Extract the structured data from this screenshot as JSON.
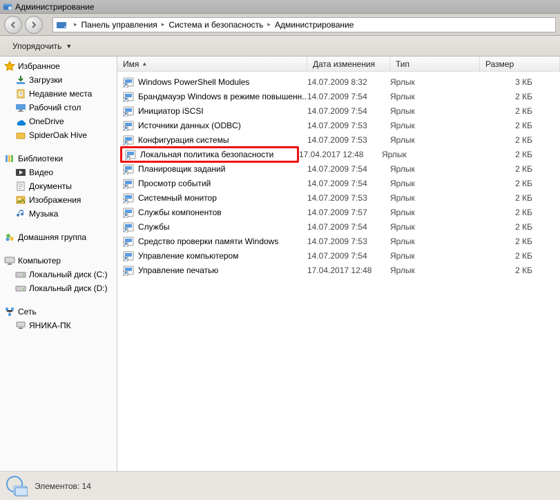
{
  "window_title": "Администрирование",
  "breadcrumbs": [
    "Панель управления",
    "Система и безопасность",
    "Администрирование"
  ],
  "toolbar": {
    "organize": "Упорядочить"
  },
  "columns": {
    "name": "Имя",
    "date": "Дата изменения",
    "type": "Тип",
    "size": "Размер"
  },
  "sidebar": {
    "groups": [
      {
        "header": "Избранное",
        "icon": "star-icon",
        "items": [
          {
            "icon": "download-icon",
            "label": "Загрузки"
          },
          {
            "icon": "recent-icon",
            "label": "Недавние места"
          },
          {
            "icon": "desktop-icon",
            "label": "Рабочий стол"
          },
          {
            "icon": "onedrive-icon",
            "label": "OneDrive"
          },
          {
            "icon": "spideroak-icon",
            "label": "SpiderOak Hive"
          }
        ]
      },
      {
        "header": "Библиотеки",
        "icon": "libraries-icon",
        "items": [
          {
            "icon": "video-icon",
            "label": "Видео"
          },
          {
            "icon": "docs-icon",
            "label": "Документы"
          },
          {
            "icon": "images-icon",
            "label": "Изображения"
          },
          {
            "icon": "music-icon",
            "label": "Музыка"
          }
        ]
      },
      {
        "header": "Домашняя группа",
        "icon": "homegroup-icon",
        "items": []
      },
      {
        "header": "Компьютер",
        "icon": "computer-icon",
        "items": [
          {
            "icon": "drive-icon",
            "label": "Локальный диск (C:)"
          },
          {
            "icon": "drive-icon",
            "label": "Локальный диск (D:)"
          }
        ]
      },
      {
        "header": "Сеть",
        "icon": "network-icon",
        "items": [
          {
            "icon": "pc-icon",
            "label": "ЯНИКА-ПК"
          }
        ]
      }
    ]
  },
  "files": [
    {
      "name": "Windows PowerShell Modules",
      "date": "14.07.2009 8:32",
      "type": "Ярлык",
      "size": "3 КБ",
      "highlight": false
    },
    {
      "name": "Брандмауэр Windows в режиме повышенн...",
      "date": "14.07.2009 7:54",
      "type": "Ярлык",
      "size": "2 КБ",
      "highlight": false
    },
    {
      "name": "Инициатор iSCSI",
      "date": "14.07.2009 7:54",
      "type": "Ярлык",
      "size": "2 КБ",
      "highlight": false
    },
    {
      "name": "Источники данных (ODBC)",
      "date": "14.07.2009 7:53",
      "type": "Ярлык",
      "size": "2 КБ",
      "highlight": false
    },
    {
      "name": "Конфигурация системы",
      "date": "14.07.2009 7:53",
      "type": "Ярлык",
      "size": "2 КБ",
      "highlight": false
    },
    {
      "name": "Локальная политика безопасности",
      "date": "17.04.2017 12:48",
      "type": "Ярлык",
      "size": "2 КБ",
      "highlight": true
    },
    {
      "name": "Планировщик заданий",
      "date": "14.07.2009 7:54",
      "type": "Ярлык",
      "size": "2 КБ",
      "highlight": false
    },
    {
      "name": "Просмотр событий",
      "date": "14.07.2009 7:54",
      "type": "Ярлык",
      "size": "2 КБ",
      "highlight": false
    },
    {
      "name": "Системный монитор",
      "date": "14.07.2009 7:53",
      "type": "Ярлык",
      "size": "2 КБ",
      "highlight": false
    },
    {
      "name": "Службы компонентов",
      "date": "14.07.2009 7:57",
      "type": "Ярлык",
      "size": "2 КБ",
      "highlight": false
    },
    {
      "name": "Службы",
      "date": "14.07.2009 7:54",
      "type": "Ярлык",
      "size": "2 КБ",
      "highlight": false
    },
    {
      "name": "Средство проверки памяти Windows",
      "date": "14.07.2009 7:53",
      "type": "Ярлык",
      "size": "2 КБ",
      "highlight": false
    },
    {
      "name": "Управление компьютером",
      "date": "14.07.2009 7:54",
      "type": "Ярлык",
      "size": "2 КБ",
      "highlight": false
    },
    {
      "name": "Управление печатью",
      "date": "17.04.2017 12:48",
      "type": "Ярлык",
      "size": "2 КБ",
      "highlight": false
    }
  ],
  "status": {
    "elements_label": "Элементов:",
    "count": "14"
  }
}
